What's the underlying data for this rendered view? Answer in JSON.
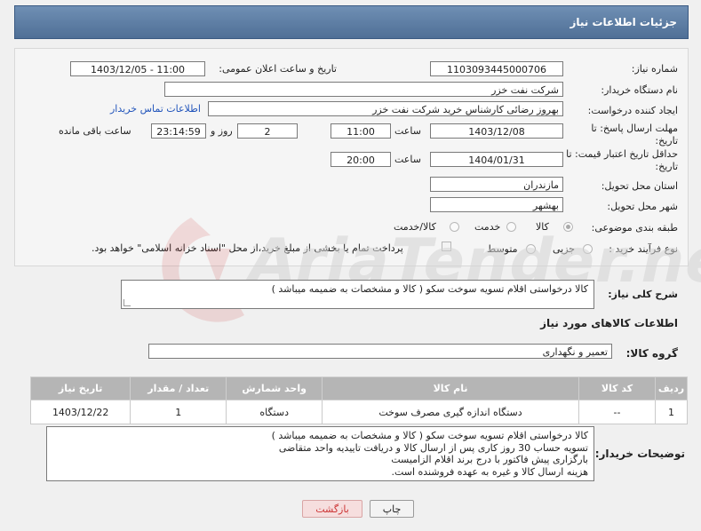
{
  "header": {
    "title": "جزئیات اطلاعات نیاز"
  },
  "fields": {
    "need_number_label": "شماره نیاز:",
    "need_number": "1103093445000706",
    "announce_label": "تاریخ و ساعت اعلان عمومی:",
    "announce_value": "1403/12/05 - 11:00",
    "buyer_org_label": "نام دستگاه خریدار:",
    "buyer_org": "شرکت نفت خزر",
    "creator_label": "ایجاد کننده درخواست:",
    "creator": "بهروز رضائی کارشناس خرید شرکت نفت خزر",
    "contact_link": "اطلاعات تماس خریدار",
    "deadline_label_1": "مهلت ارسال پاسخ: تا",
    "deadline_label_2": "تاریخ:",
    "deadline_date": "1403/12/08",
    "hour_label": "ساعت",
    "deadline_time": "11:00",
    "days": "2",
    "days_label": "روز و",
    "remaining_time": "23:14:59",
    "remaining_label": "ساعت باقی مانده",
    "validity_label_1": "حداقل تاریخ اعتبار قیمت: تا",
    "validity_label_2": "تاریخ:",
    "validity_date": "1404/01/31",
    "validity_time": "20:00",
    "province_label": "استان محل تحویل:",
    "province": "مازندران",
    "city_label": "شهر محل تحویل:",
    "city": "بهشهر",
    "category_label": "طبقه بندی موضوعی:",
    "category_options": [
      "کالا",
      "خدمت",
      "کالا/خدمت"
    ],
    "process_label": "نوع فرآیند خرید :",
    "process_options": [
      "جزیی",
      "متوسط"
    ],
    "payment_note": "پرداخت تمام یا بخشی از مبلغ خرید،از محل \"اسناد خزانه اسلامی\" خواهد بود."
  },
  "description": {
    "label": "شرح کلی نیاز:",
    "value": "کالا درخواستی اقلام تسویه سوخت سکو ( کالا و مشخصات به ضمیمه میباشد )"
  },
  "goods_info": {
    "title": "اطلاعات کالاهای مورد نیاز",
    "group_label": "گروه کالا:",
    "group_value": "تعمیر و نگهداری"
  },
  "table": {
    "headers": [
      "ردیف",
      "کد کالا",
      "نام کالا",
      "واحد شمارش",
      "تعداد / مقدار",
      "تاریخ نیاز"
    ],
    "rows": [
      [
        "1",
        "--",
        "دستگاه اندازه گیری مصرف سوخت",
        "دستگاه",
        "1",
        "1403/12/22"
      ]
    ]
  },
  "buyer_notes": {
    "label": "توضیحات خریدار:",
    "lines": [
      "کالا درخواستی اقلام تسویه سوخت سکو ( کالا و مشخصات به ضمیمه میباشد )",
      "تسویه حساب 30 روز کاری پس از ارسال کالا و  دریافت تاییدیه واحد متقاضی",
      "بارگزاری پیش فاکتور با درج برند اقلام الزامیست",
      "هزینه ارسال کالا و غیره به عهده فروشنده است."
    ]
  },
  "buttons": {
    "print": "چاپ",
    "back": "بازگشت"
  },
  "watermark": {
    "text": "AriaTender.net"
  }
}
